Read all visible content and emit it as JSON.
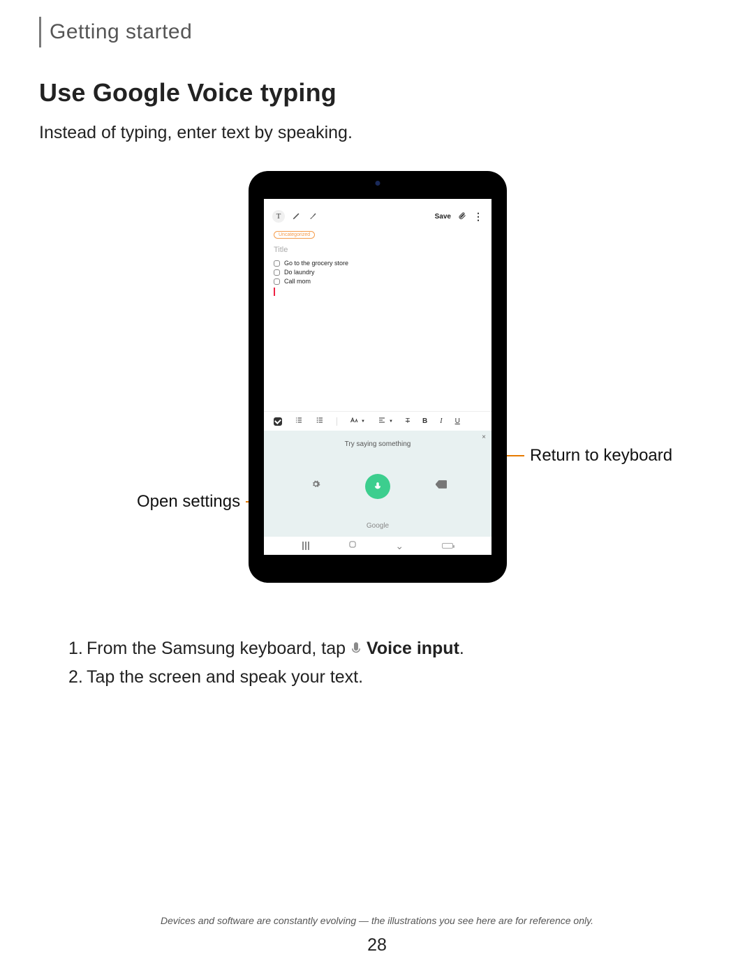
{
  "breadcrumb": "Getting started",
  "title": "Use Google Voice typing",
  "intro": "Instead of typing, enter text by speaking.",
  "tablet": {
    "topbar": {
      "text_tool": "T",
      "save": "Save"
    },
    "note": {
      "tag": "Uncategorized",
      "title_placeholder": "Title",
      "items": [
        "Go to the grocery store",
        "Do laundry",
        "Call mom"
      ]
    },
    "format_bar": {
      "strike": "T",
      "bold": "B",
      "italic": "I",
      "underline": "U"
    },
    "voice": {
      "prompt": "Try saying something",
      "close": "×",
      "brand": "Google"
    }
  },
  "callouts": {
    "open_settings": "Open settings",
    "return_keyboard": "Return to keyboard"
  },
  "steps": {
    "s1_num": "1.",
    "s1_a": "From the Samsung keyboard, tap",
    "s1_b": "Voice input",
    "s1_c": ".",
    "s2_num": "2.",
    "s2": "Tap the screen and speak your text."
  },
  "footer": "Devices and software are constantly evolving — the illustrations you see here are for reference only.",
  "page_number": "28"
}
